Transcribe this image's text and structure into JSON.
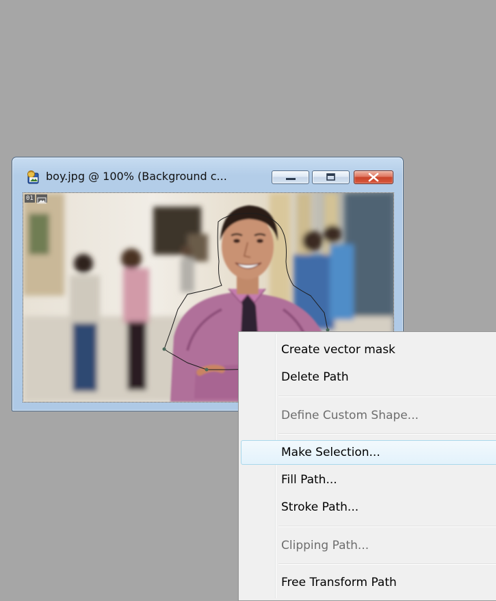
{
  "document_window": {
    "title": "boy.jpg @ 100% (Background c...",
    "layer_number": "01",
    "buttons": {
      "minimize": "minimize-icon",
      "maximize": "maximize-icon",
      "close": "close-icon"
    }
  },
  "context_menu": {
    "items": [
      {
        "label": "Create vector mask",
        "enabled": true,
        "highlighted": false
      },
      {
        "label": "Delete Path",
        "enabled": true,
        "highlighted": false
      },
      {
        "label": "Define Custom Shape...",
        "enabled": false,
        "highlighted": false
      },
      {
        "label": "Make Selection...",
        "enabled": true,
        "highlighted": true
      },
      {
        "label": "Fill Path...",
        "enabled": true,
        "highlighted": false
      },
      {
        "label": "Stroke Path...",
        "enabled": true,
        "highlighted": false
      },
      {
        "label": "Clipping Path...",
        "enabled": false,
        "highlighted": false
      },
      {
        "label": "Free Transform Path",
        "enabled": true,
        "highlighted": false
      }
    ]
  },
  "colors": {
    "workspace_background": "#a6a6a6",
    "window_frame": "#b3cde8",
    "close_button": "#c8442a",
    "menu_background": "#f0f0f0",
    "menu_highlight": "#e3f2fb"
  }
}
